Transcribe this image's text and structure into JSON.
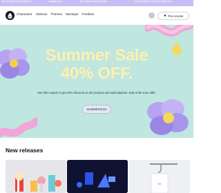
{
  "ticker": {
    "items": [
      "50% OFF PRO SALE PRODUCTS",
      "SUMMER SALE",
      "GET SUMMER 40% DISCOUNT",
      "40% OFF PRO SALE ON ALL PRODUCTS",
      "50% OFF PRO SALE PRODUCTS"
    ]
  },
  "nav": {
    "logo_icon": "drop-mascot-logo",
    "links": [
      "Characters",
      "Abstract",
      "Themes",
      "Mockups",
      "Freebies"
    ],
    "pro_button": {
      "icon": "star-icon",
      "label": "Pro Access"
    }
  },
  "hero": {
    "title_line1": "Summer Sale",
    "title_line2": "40% OFF.",
    "description": "Use this coupon to get 40% discount on all products and subscriptions. Sale ends June 28th.",
    "coupon_code": "SUMMER2024",
    "colors": {
      "background": "#bfe6df",
      "title": "#fdf0b2",
      "shape_purple": "#a996ec",
      "shape_pink": "#f0a6d6",
      "shape_yellow": "#f5d85c"
    }
  },
  "new_releases": {
    "title": "New releases",
    "cards": [
      "3d-popcorn-cinema-scene",
      "3d-neon-blue-objects",
      "3d-bag-hanging-hook"
    ]
  }
}
